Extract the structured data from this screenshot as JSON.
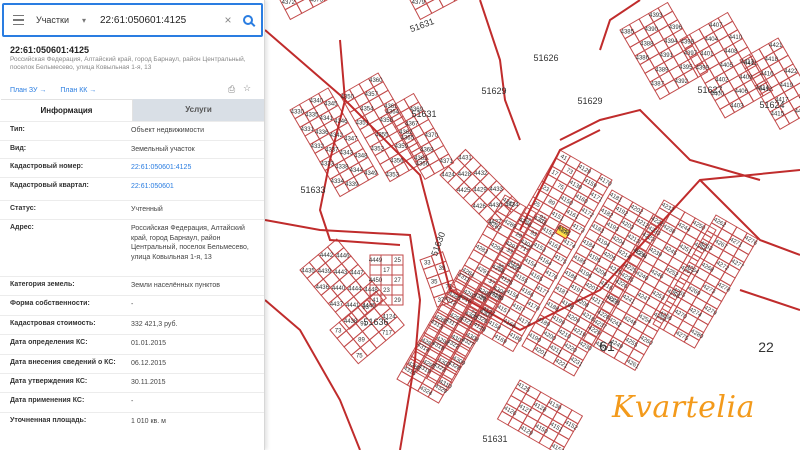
{
  "search": {
    "layer": "Участки",
    "query": "22:61:050601:4125"
  },
  "object": {
    "title": "22:61:050601:4125",
    "address": "Российская Федерация, Алтайский край, город Барнаул, район Центральный, поселок Бельмесево, улица Ковыльная 1-я, 13"
  },
  "links": {
    "plan_zu": "План ЗУ →",
    "plan_kk": "План КК →"
  },
  "tabs": [
    {
      "label": "Информация",
      "active": true
    },
    {
      "label": "Услуги",
      "active": false
    }
  ],
  "info": [
    {
      "label": "Тип:",
      "value": "Объект недвижимости"
    },
    {
      "label": "Вид:",
      "value": "Земельный участок"
    },
    {
      "label": "Кадастровый номер:",
      "value": "22:61:050601:4125",
      "link": true
    },
    {
      "label": "Кадастровый квартал:",
      "value": "22:61:050601",
      "link": true
    },
    {
      "label": "Статус:",
      "value": "Учтенный"
    },
    {
      "label": "Адрес:",
      "value": "Российская Федерация, Алтайский край, город Барнаул, район Центральный, поселок Бельмесево, улица Ковыльная 1-я, 13"
    },
    {
      "label": "Категория земель:",
      "value": "Земли населённых пунктов"
    },
    {
      "label": "Форма собственности:",
      "value": "-"
    },
    {
      "label": "Кадастровая стоимость:",
      "value": "332 421,3 руб."
    },
    {
      "label": "Дата определения КС:",
      "value": "01.01.2015"
    },
    {
      "label": "Дата внесения сведений о КС:",
      "value": "06.12.2015"
    },
    {
      "label": "Дата утверждения КС:",
      "value": "30.11.2015"
    },
    {
      "label": "Дата применения КС:",
      "value": "-"
    },
    {
      "label": "Уточненная площадь:",
      "value": "1 010 кв. м"
    }
  ],
  "map": {
    "zone_labels": [
      "51631",
      "51626",
      "51629",
      "51627",
      "51624",
      "51633",
      "51636",
      "51630",
      "22",
      "61",
      "51631",
      "51629",
      "51631"
    ],
    "plot_labels": [
      "41",
      "17",
      "23",
      "25",
      "27",
      "29",
      "33",
      "35",
      "37",
      "39",
      "71",
      "73",
      "75",
      "89",
      "91",
      "93",
      "717",
      "4124",
      "4125",
      "4126",
      "4127",
      "4128",
      "4129",
      "4130",
      "4150",
      "4151",
      "4152",
      "4153",
      "4154",
      "4155",
      "4156",
      "4157",
      "4158",
      "4159",
      "4160",
      "4161",
      "4162",
      "4163",
      "4164",
      "4165",
      "4166",
      "4167",
      "4168",
      "4169",
      "4170",
      "4171",
      "4172",
      "4173",
      "4174",
      "4175",
      "4176",
      "4177",
      "4178",
      "4179",
      "4180",
      "4181",
      "4182",
      "4183",
      "4184",
      "4185",
      "4186",
      "4187",
      "4188",
      "4189",
      "4190",
      "4192",
      "4193",
      "4194",
      "4195",
      "4196",
      "4197",
      "4198",
      "4199",
      "4200",
      "4201",
      "4202",
      "4203",
      "4204",
      "4205",
      "4206",
      "4207",
      "4208",
      "4209",
      "4210",
      "4211",
      "4212",
      "4213",
      "4214",
      "4215",
      "4216",
      "4217",
      "4218",
      "4219",
      "4220",
      "4221",
      "4222",
      "4223",
      "4224",
      "4225",
      "4226",
      "4227",
      "4228",
      "4229",
      "4230",
      "4231",
      "4232",
      "4233",
      "4234",
      "4235",
      "4236",
      "4237",
      "4238",
      "4239",
      "4240",
      "4241",
      "4242",
      "4243",
      "4244",
      "4245",
      "4246",
      "4247",
      "4248",
      "4249",
      "4250",
      "4251",
      "4252",
      "4253",
      "4254",
      "4255",
      "4256",
      "4257",
      "4258",
      "4259",
      "4260",
      "4261",
      "4262",
      "4263",
      "4264",
      "4265",
      "4266",
      "4267",
      "4268",
      "4269",
      "4270",
      "4271",
      "4272",
      "4273",
      "4274",
      "4275",
      "4276",
      "4277",
      "4278",
      "4279",
      "4280",
      "4281",
      "4282",
      "4283",
      "4284",
      "4285",
      "4286",
      "4287",
      "4288",
      "4289",
      "4290",
      "4291",
      "4292",
      "4293",
      "4294",
      "4295",
      "4296",
      "4297",
      "4298",
      "4299",
      "4300",
      "4301",
      "4302",
      "4303",
      "4304",
      "4305",
      "4306",
      "4307",
      "4308",
      "4309",
      "4310",
      "4311",
      "4312",
      "4313",
      "4314",
      "4315",
      "4316",
      "4317",
      "4318",
      "4319",
      "4320",
      "4321",
      "4322",
      "4323",
      "4324",
      "4325",
      "4326",
      "4327",
      "4328",
      "4329",
      "4330",
      "4331",
      "4332",
      "4333",
      "4334",
      "4335",
      "4336",
      "4337",
      "4338",
      "4339",
      "4340",
      "4341",
      "4342",
      "4343",
      "4344",
      "4345",
      "4346",
      "4347",
      "4348",
      "4349",
      "4350",
      "4351",
      "4352",
      "4353",
      "4354",
      "4355",
      "4356",
      "4357",
      "4358",
      "4359",
      "4360",
      "4361",
      "4362",
      "4363",
      "4364",
      "4365",
      "4366",
      "4367",
      "4368",
      "4369",
      "4370",
      "4371",
      "4372",
      "4373",
      "4374",
      "4375",
      "4376",
      "4377",
      "4378",
      "4379",
      "4380",
      "4381",
      "4382",
      "4383",
      "4384",
      "4385",
      "4386",
      "4387",
      "4388",
      "4389",
      "4390",
      "4391",
      "4392",
      "4393",
      "4394",
      "4395",
      "4396",
      "4397",
      "4398",
      "4399",
      "4400",
      "4401",
      "4402",
      "4403",
      "4404",
      "4405",
      "4406",
      "4407",
      "4408",
      "4409",
      "4410",
      "4411",
      "4412",
      "4413",
      "4414",
      "4415",
      "4416",
      "4417",
      "4418",
      "4419",
      "4420",
      "4421",
      "4422",
      "4423",
      "4424",
      "4425",
      "4426",
      "4427",
      "4428",
      "4429",
      "4430",
      "4431",
      "4432",
      "4433",
      "4434",
      "4435",
      "4436",
      "4437",
      "4438",
      "4439",
      "4440",
      "4441",
      "4442",
      "4443",
      "4444",
      "4445",
      "4446",
      "4447",
      "4448",
      "4449",
      "4450"
    ],
    "selected_plot": "4125",
    "watermark": "Kvartelia",
    "colors": {
      "parcel_line": "#c24a4a",
      "selected": "#ffe24a",
      "accent": "#2a7de1",
      "watermark": "#f39a1b"
    }
  }
}
